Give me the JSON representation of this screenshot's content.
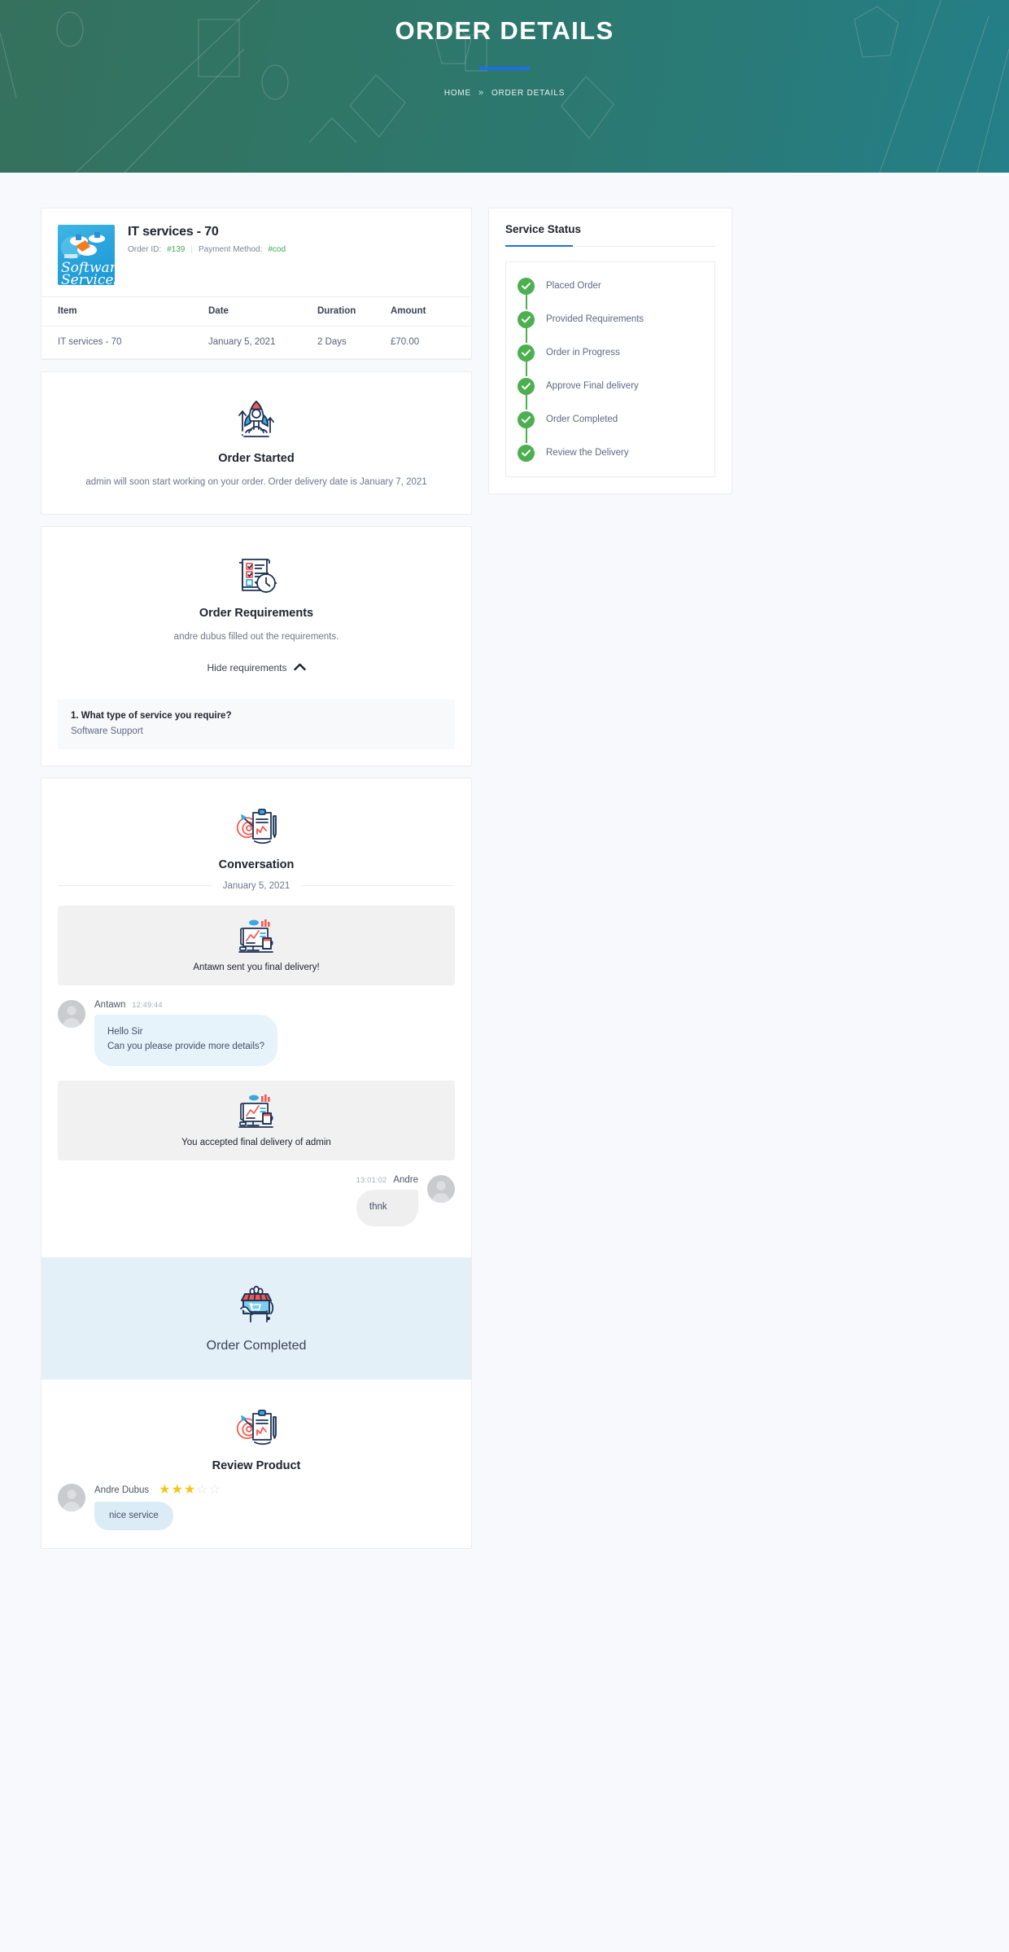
{
  "banner": {
    "title": "ORDER DETAILS",
    "breadcrumb_home": "HOME",
    "breadcrumb_sep": "»",
    "breadcrumb_current": "ORDER DETAILS",
    "accent_color": "#1e6fe0"
  },
  "order": {
    "thumb_line1": "Software",
    "thumb_line2": "Services",
    "title": "IT services - 70",
    "order_id_label": "Order ID:",
    "order_id_value": "#139",
    "divider": "|",
    "payment_label": "Payment Method:",
    "payment_value": "#cod",
    "value_color": "#3dab5a"
  },
  "items_table": {
    "headers": [
      "Item",
      "Date",
      "Duration",
      "Amount"
    ],
    "rows": [
      [
        "IT services - 70",
        "January 5, 2021",
        "2 Days",
        "£70.00"
      ]
    ]
  },
  "order_started": {
    "icon": "rocket-icon",
    "title": "Order Started",
    "description": "admin will soon start working on your order. Order delivery date is January 7, 2021"
  },
  "requirements": {
    "icon": "checklist-stopwatch-icon",
    "title": "Order Requirements",
    "description": "andre dubus filled out the requirements.",
    "toggle_label": "Hide requirements",
    "toggle_icon": "chevron-up-icon",
    "items": [
      {
        "question": "1. What type of service you require?",
        "answer": "Software Support"
      }
    ]
  },
  "conversation": {
    "icon": "clipboard-target-icon",
    "title": "Conversation",
    "date": "January 5, 2021",
    "messages": [
      {
        "kind": "system",
        "icon": "desktop-chart-icon",
        "text": "Antawn sent you final delivery!"
      },
      {
        "kind": "incoming",
        "avatar": "user-avatar",
        "name": "Antawn",
        "time": "12:49:44",
        "line1": "Hello Sir",
        "line2": "Can you please provide more  details?"
      },
      {
        "kind": "system",
        "icon": "desktop-chart-icon",
        "text": "You accepted final delivery of admin"
      },
      {
        "kind": "outgoing",
        "avatar": "user-avatar",
        "name": "Andre",
        "time": "13:01:02",
        "line1": "thnk"
      }
    ]
  },
  "order_completed": {
    "icon": "shop-cart-icon",
    "title": "Order Completed",
    "background": "#e4f0f8"
  },
  "review": {
    "icon": "clipboard-target-icon",
    "title": "Review Product",
    "reviewer": "Andre Dubus",
    "rating": 3,
    "max_rating": 5,
    "star_on": "★",
    "star_off": "☆",
    "comment": "nice service"
  },
  "service_status": {
    "title": "Service Status",
    "steps": [
      {
        "label": "Placed Order",
        "done": true
      },
      {
        "label": "Provided Requirements",
        "done": true
      },
      {
        "label": "Order in Progress",
        "done": true
      },
      {
        "label": "Approve Final delivery",
        "done": true
      },
      {
        "label": "Order Completed",
        "done": true
      },
      {
        "label": "Review the Delivery",
        "done": true
      }
    ],
    "done_color": "#4caf50"
  }
}
